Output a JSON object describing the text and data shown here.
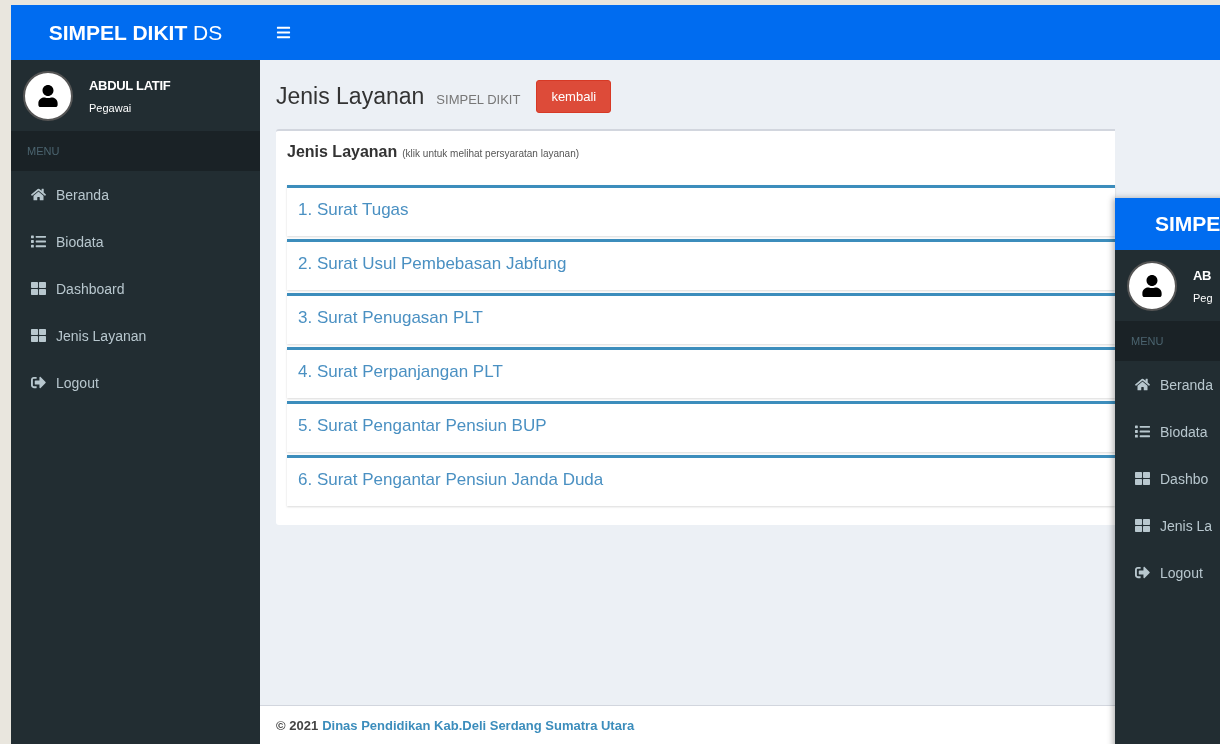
{
  "header": {
    "brand_bold": "SIMPEL DIKIT",
    "brand_light": "DS"
  },
  "user": {
    "name": "ABDUL LATIF",
    "role": "Pegawai"
  },
  "sidebar": {
    "heading": "MENU",
    "items": [
      {
        "label": "Beranda",
        "kind": "home"
      },
      {
        "label": "Biodata",
        "kind": "list"
      },
      {
        "label": "Dashboard",
        "kind": "grid"
      },
      {
        "label": "Jenis Layanan",
        "kind": "grid"
      },
      {
        "label": "Logout",
        "kind": "logout"
      }
    ]
  },
  "content_header": {
    "title": "Jenis Layanan",
    "subtitle": "SIMPEL DIKIT",
    "back_button": "kembali"
  },
  "box": {
    "title": "Jenis Layanan",
    "hint": "(klik untuk melihat persyaratan layanan)",
    "items": [
      "1. Surat Tugas",
      "2. Surat Usul Pembebasan Jabfung",
      "3. Surat Penugasan PLT",
      "4. Surat Perpanjangan PLT",
      "5. Surat Pengantar Pensiun BUP",
      "6. Surat Pengantar Pensiun Janda Duda"
    ]
  },
  "footer": {
    "copyright": "© 2021",
    "link": "Dinas Pendidikan Kab.Deli Serdang Sumatra Utara"
  },
  "overlay_window": {
    "brand": "SIMPE",
    "user_name": "AB",
    "user_role": "Peg",
    "heading": "MENU",
    "items": [
      {
        "label": "Beranda",
        "kind": "home"
      },
      {
        "label": "Biodata",
        "kind": "list"
      },
      {
        "label": "Dashbo",
        "kind": "grid"
      },
      {
        "label": "Jenis La",
        "kind": "grid"
      },
      {
        "label": "Logout",
        "kind": "logout"
      }
    ]
  }
}
